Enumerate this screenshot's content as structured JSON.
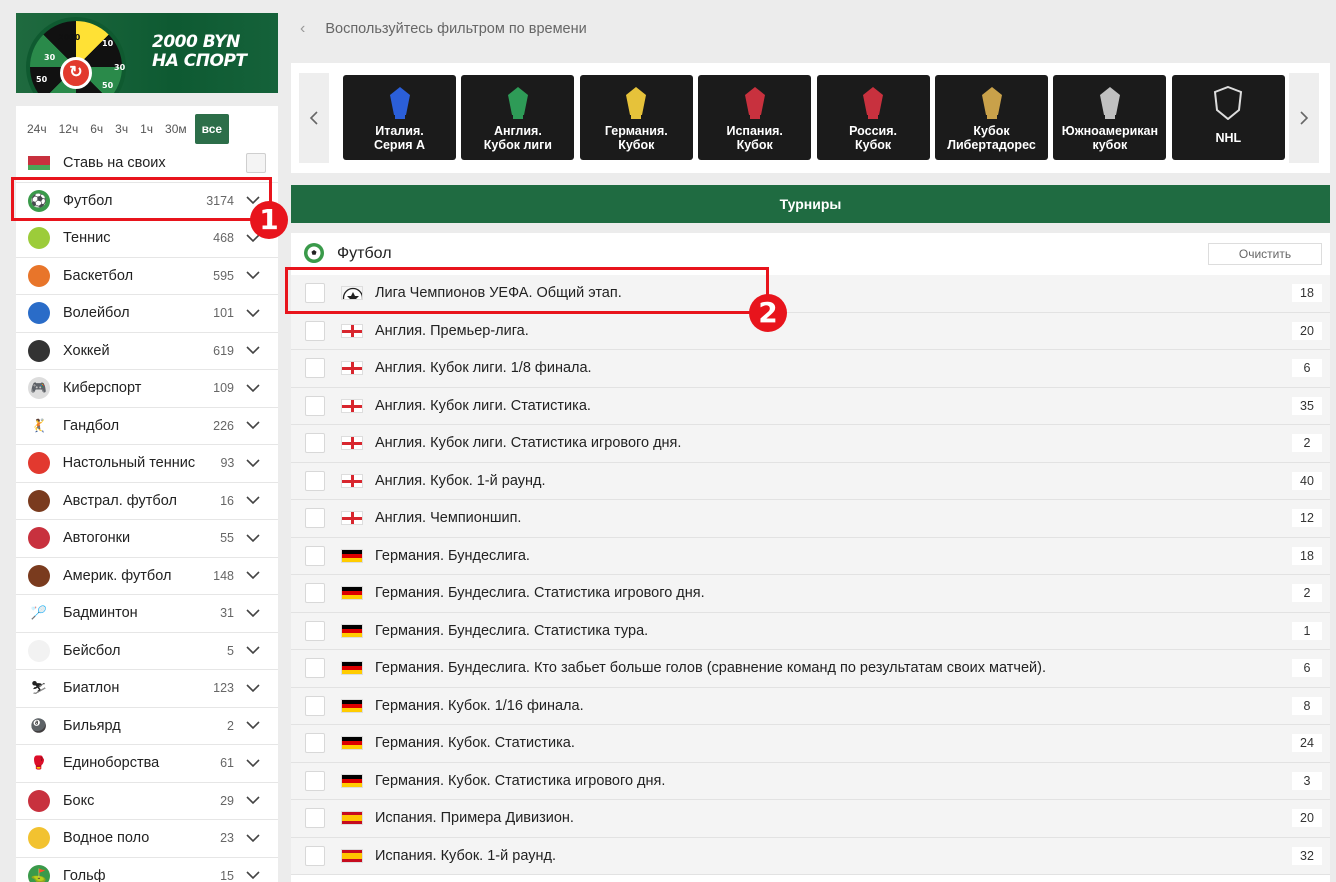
{
  "banner": {
    "line1": "2000 BYN",
    "line2": "НА СПОРТ",
    "wheel_labels": [
      "2000",
      "10",
      "30",
      "30",
      "50",
      "50"
    ]
  },
  "time_filter": {
    "options": [
      "24ч",
      "12ч",
      "6ч",
      "3ч",
      "1ч",
      "30м",
      "все"
    ],
    "active": "все"
  },
  "sidebar": {
    "bet_on_own": "Ставь на своих",
    "sports": [
      {
        "name": "Футбол",
        "count": "3174"
      },
      {
        "name": "Теннис",
        "count": "468"
      },
      {
        "name": "Баскетбол",
        "count": "595"
      },
      {
        "name": "Волейбол",
        "count": "101"
      },
      {
        "name": "Хоккей",
        "count": "619"
      },
      {
        "name": "Киберспорт",
        "count": "109"
      },
      {
        "name": "Гандбол",
        "count": "226"
      },
      {
        "name": "Настольный теннис",
        "count": "93"
      },
      {
        "name": "Австрал. футбол",
        "count": "16"
      },
      {
        "name": "Автогонки",
        "count": "55"
      },
      {
        "name": "Америк. футбол",
        "count": "148"
      },
      {
        "name": "Бадминтон",
        "count": "31"
      },
      {
        "name": "Бейсбол",
        "count": "5"
      },
      {
        "name": "Биатлон",
        "count": "123"
      },
      {
        "name": "Бильярд",
        "count": "2"
      },
      {
        "name": "Единоборства",
        "count": "61"
      },
      {
        "name": "Бокс",
        "count": "29"
      },
      {
        "name": "Водное поло",
        "count": "23"
      },
      {
        "name": "Гольф",
        "count": "15"
      }
    ]
  },
  "main": {
    "time_hint": "Воспользуйтесь фильтром по времени",
    "leagues": [
      "Италия.\nСерия А",
      "Англия.\nКубок лиги",
      "Германия.\nКубок",
      "Испания.\nКубок",
      "Россия.\nКубок",
      "Кубок\nЛибертадорес",
      "Южноамерикан\nкубок",
      "NHL"
    ],
    "tournaments_label": "Турниры",
    "football_title": "Футбол",
    "clear_label": "Очистить",
    "rows": [
      {
        "name": "Лига Чемпионов УЕФА. Общий этап.",
        "count": "18",
        "flag": "ucl"
      },
      {
        "name": "Англия. Премьер-лига.",
        "count": "20",
        "flag": "eng"
      },
      {
        "name": "Англия. Кубок лиги. 1/8 финала.",
        "count": "6",
        "flag": "eng"
      },
      {
        "name": "Англия. Кубок лиги. Статистика.",
        "count": "35",
        "flag": "eng"
      },
      {
        "name": "Англия. Кубок лиги. Статистика игрового дня.",
        "count": "2",
        "flag": "eng"
      },
      {
        "name": "Англия. Кубок. 1-й раунд.",
        "count": "40",
        "flag": "eng"
      },
      {
        "name": "Англия. Чемпионшип.",
        "count": "12",
        "flag": "eng"
      },
      {
        "name": "Германия. Бундеслига.",
        "count": "18",
        "flag": "ger"
      },
      {
        "name": "Германия. Бундеслига. Статистика игрового дня.",
        "count": "2",
        "flag": "ger"
      },
      {
        "name": "Германия. Бундеслига. Статистика тура.",
        "count": "1",
        "flag": "ger"
      },
      {
        "name": "Германия. Бундеслига. Кто забьет больше голов (сравнение команд по результатам своих матчей).",
        "count": "6",
        "flag": "ger"
      },
      {
        "name": "Германия. Кубок. 1/16 финала.",
        "count": "8",
        "flag": "ger"
      },
      {
        "name": "Германия. Кубок. Статистика.",
        "count": "24",
        "flag": "ger"
      },
      {
        "name": "Германия. Кубок. Статистика игрового дня.",
        "count": "3",
        "flag": "ger"
      },
      {
        "name": "Испания. Примера Дивизион.",
        "count": "20",
        "flag": "esp"
      },
      {
        "name": "Испания. Кубок. 1-й раунд.",
        "count": "32",
        "flag": "esp"
      }
    ]
  },
  "annotations": [
    "1",
    "2"
  ],
  "colors": {
    "brand_green": "#1f6b41",
    "annotation_red": "#e8141c"
  }
}
